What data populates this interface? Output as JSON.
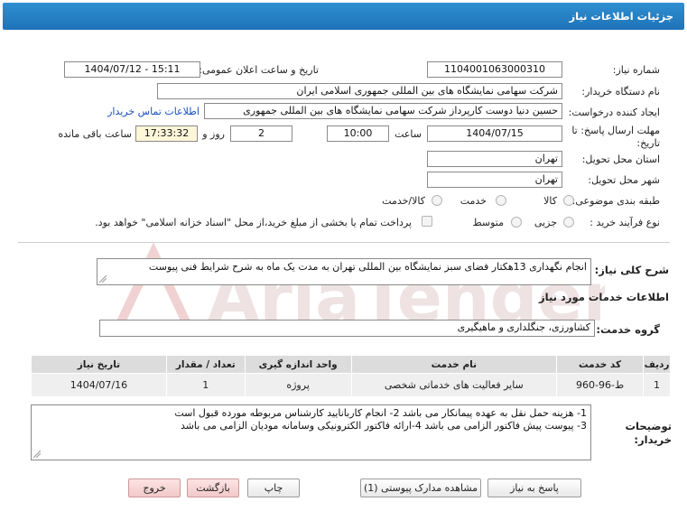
{
  "header": {
    "title": "جزئیات اطلاعات نیاز"
  },
  "fields": {
    "need_number_label": "شماره نیاز:",
    "need_number": "1104001063000310",
    "announce_label": "تاریخ و ساعت اعلان عمومی:",
    "announce_value": "1404/07/12 - 15:11",
    "buyer_org_label": "نام دستگاه خریدار:",
    "buyer_org": "شرکت سهامی نمایشگاه های بین المللی جمهوری اسلامی ایران",
    "requester_label": "ایجاد کننده درخواست:",
    "requester": "حسین دنیا دوست کارپرداز شرکت سهامی نمایشگاه های بین المللی جمهوری",
    "contact_link": "اطلاعات تماس خریدار",
    "deadline_label_1": "مهلت ارسال پاسخ: تا",
    "deadline_label_2": "تاریخ:",
    "deadline_date": "1404/07/15",
    "time_label": "ساعت",
    "deadline_time": "10:00",
    "days_value": "2",
    "days_label": "روز و",
    "remaining_time": "17:33:32",
    "remaining_label": "ساعت باقی مانده",
    "province_label": "استان محل تحویل:",
    "province": "تهران",
    "city_label": "شهر محل تحویل:",
    "city": "تهران",
    "category_label": "طبقه بندی موضوعی:",
    "category_options": [
      "کالا",
      "خدمت",
      "کالا/خدمت"
    ],
    "process_label": "نوع فرآیند خرید :",
    "process_options": [
      "جزیی",
      "متوسط"
    ],
    "payment_note": "پرداخت تمام یا بخشی از مبلغ خرید،از محل \"اسناد خزانه اسلامی\" خواهد بود."
  },
  "description": {
    "label": "شرح کلی نیاز:",
    "text": "انجام نگهداری 13هکتار فضای سبز نمایشگاه بین المللی تهران به مدت یک ماه به شرح شرایط فنی پیوست"
  },
  "services": {
    "section_title": "اطلاعات خدمات مورد نیاز",
    "group_label": "گروه خدمت:",
    "group_value": "کشاورزی، جنگلداری و ماهیگیری",
    "columns": [
      "ردیف",
      "کد خدمت",
      "نام خدمت",
      "واحد اندازه گیری",
      "تعداد / مقدار",
      "تاریخ نیاز"
    ],
    "rows": [
      [
        "1",
        "ط-96-960",
        "سایر فعالیت های خدماتی شخصی",
        "پروژه",
        "1",
        "1404/07/16"
      ]
    ]
  },
  "notes": {
    "label_1": "توضیحات",
    "label_2": "خریدار:",
    "line_1": "1- هزینه حمل نقل به عهده پیمانکار می باشد 2- انجام کاربانایید کارشناس مربوطه مورده قبول است",
    "line_2": "3- پیوست پیش فاکتور الزامی می باشد 4-ارائه فاکتور الکترونیکی وسامانه مودیان الزامی می باشد"
  },
  "buttons": {
    "reply": "پاسخ به نیاز",
    "attachments": "مشاهده مدارک پیوستی (1)",
    "print": "چاپ",
    "back": "بازگشت",
    "exit": "خروج"
  },
  "watermark": {
    "text": "AriaTender.net"
  },
  "colors": {
    "header": "#2478bf",
    "link": "#1a4fbf",
    "remaining_bg": "#fdf6d9"
  }
}
